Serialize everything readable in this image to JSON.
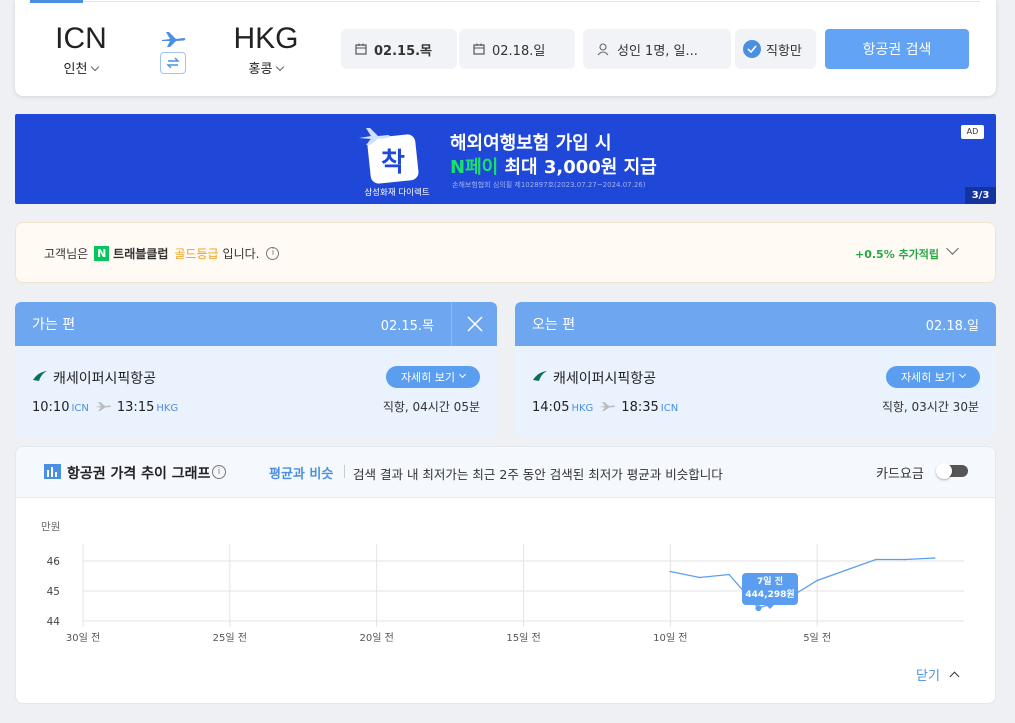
{
  "search": {
    "origin_code": "ICN",
    "origin_city": "인천",
    "dest_code": "HKG",
    "dest_city": "홍콩",
    "depart_date": "02.15.목",
    "return_date": "02.18.일",
    "passengers": "성인 1명, 일...",
    "direct_only": "직항만",
    "search_button": "항공권 검색"
  },
  "banner": {
    "title": "해외여행보험 가입 시",
    "subtitle_highlight": "N페이",
    "subtitle_rest": " 최대 3,000원 지급",
    "fineprint": "손해보험협회 심의필 제102897호(2023.07.27~2024.07.26)",
    "brand": "삼성화재 다이렉트",
    "logo_char": "착",
    "ad_label": "AD",
    "page_indicator": "3/3"
  },
  "grade": {
    "prefix": "고객님은",
    "club_badge": "N",
    "club_name": "트래블클럽",
    "tier": "골드등급",
    "suffix": "입니다.",
    "bonus": "+0.5% 추가적립"
  },
  "outbound": {
    "label": "가는 편",
    "date": "02.15.목",
    "airline": "캐세이퍼시픽항공",
    "depart_time": "10:10",
    "depart_airport": "ICN",
    "arrive_time": "13:15",
    "arrive_airport": "HKG",
    "detail_button": "자세히 보기",
    "duration": "직항, 04시간 05분"
  },
  "inbound": {
    "label": "오는 편",
    "date": "02.18.일",
    "airline": "캐세이퍼시픽항공",
    "depart_time": "14:05",
    "depart_airport": "HKG",
    "arrive_time": "18:35",
    "arrive_airport": "ICN",
    "detail_button": "자세히 보기",
    "duration": "직항, 03시간 30분"
  },
  "graph": {
    "title": "항공권 가격 추이 그래프",
    "status": "평균과 비슷",
    "description": "검색 결과 내 최저가는 최근 2주 동안 검색된 최저가 평균과 비슷합니다",
    "card_price_label": "카드요금",
    "close_label": "닫기",
    "tooltip_day": "7일 전",
    "tooltip_price": "444,298원"
  },
  "chart_data": {
    "type": "line",
    "ylabel": "만원",
    "yticks": [
      44,
      45,
      46
    ],
    "ylim": [
      44,
      46.5
    ],
    "xlim": [
      -30,
      0
    ],
    "xticks": [
      "30일 전",
      "25일 전",
      "20일 전",
      "15일 전",
      "10일 전",
      "5일 전"
    ],
    "xtick_values": [
      -30,
      -25,
      -20,
      -15,
      -10,
      -5
    ],
    "series": [
      {
        "x": [
          -10,
          -9,
          -8,
          -7,
          -6,
          -5,
          -4,
          -3,
          -2,
          -1
        ],
        "values": [
          45.65,
          45.45,
          45.55,
          44.43,
          44.75,
          45.35,
          45.7,
          46.05,
          46.05,
          46.1
        ]
      }
    ],
    "highlight": {
      "x": -7,
      "y": 44.43
    },
    "colors": {
      "line": "#5b9ef0",
      "grid": "#e3e3e3"
    }
  }
}
